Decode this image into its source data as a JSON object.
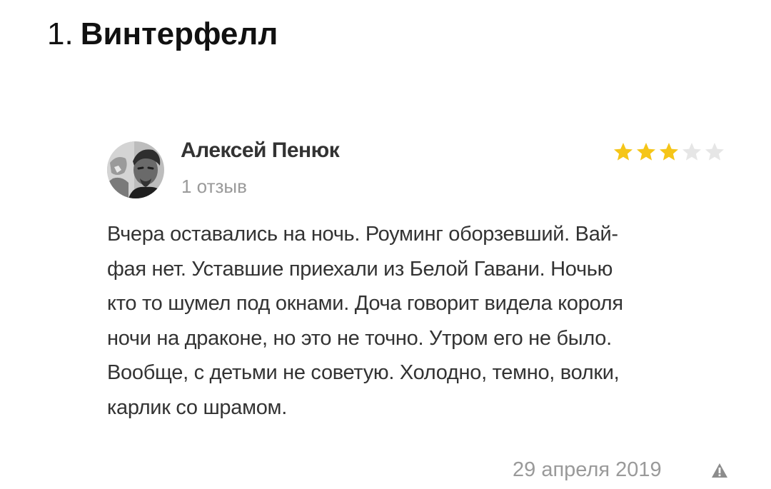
{
  "heading": {
    "number": "1.",
    "title": "Винтерфелл"
  },
  "review": {
    "author": {
      "name": "Алексей Пенюк",
      "review_count": "1 отзыв",
      "avatar_icon": "user-photo-avatar"
    },
    "rating": {
      "value": 3,
      "max": 5,
      "filled_color": "#f5c518",
      "empty_color": "#e6e6e6"
    },
    "text_lines": [
      "Вчера оставались на ночь. Роуминг оборзевший. Вай-",
      "фая нет. Уставшие приехали из Белой Гавани. Ночью",
      "кто то шумел под окнами. Доча говорит видела короля",
      "ночи на драконе, но это не точно. Утром его не было.",
      "Вообще, с детьми не советую. Холодно, темно, волки,",
      "карлик со шрамом."
    ],
    "date": "29 апреля 2019",
    "report_icon": "warning-triangle-icon"
  }
}
